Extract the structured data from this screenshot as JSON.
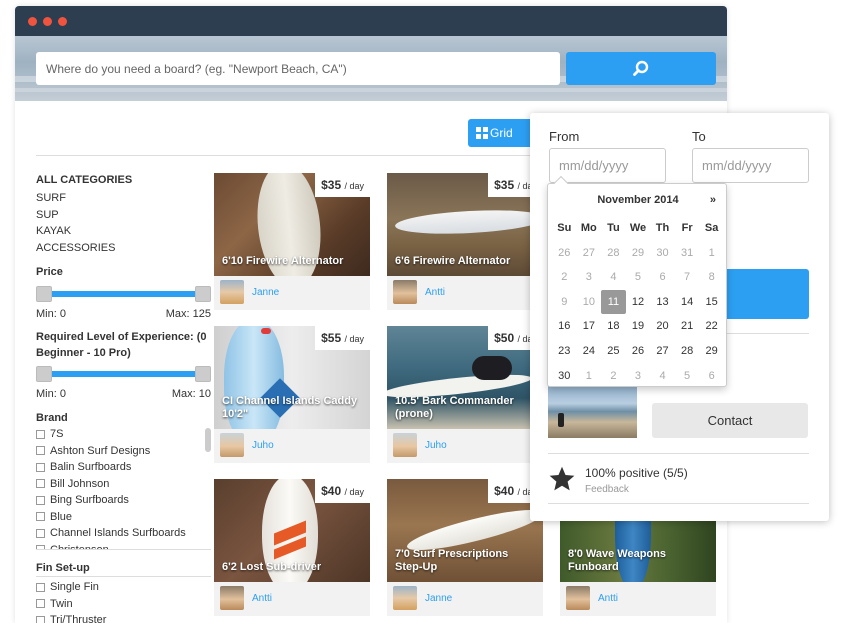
{
  "search": {
    "placeholder": "Where do you need a board? (eg. \"Newport Beach, CA\")",
    "button_icon": "search-icon"
  },
  "toolbar": {
    "grid_label": "Grid"
  },
  "sidebar": {
    "categories_title": "ALL CATEGORIES",
    "categories": [
      "SURF",
      "SUP",
      "KAYAK",
      "ACCESSORIES"
    ],
    "price": {
      "label": "Price",
      "min_label": "Min: 0",
      "max_label": "Max: 125"
    },
    "experience": {
      "label": "Required Level of Experience: (0 Beginner - 10 Pro)",
      "min_label": "Min: 0",
      "max_label": "Max: 10"
    },
    "brand": {
      "label": "Brand",
      "items": [
        "7S",
        "Ashton Surf Designs",
        "Balin Surfboards",
        "Bill Johnson",
        "Bing Surfboards",
        "Blue",
        "Channel Islands Surfboards",
        "Christenson"
      ]
    },
    "fin": {
      "label": "Fin Set-up",
      "items": [
        "Single Fin",
        "Twin",
        "Tri/Thruster"
      ]
    }
  },
  "listings": [
    {
      "title": "6'10 Firewire Alternator",
      "price": "$35",
      "unit": "/ day",
      "owner": "Janne"
    },
    {
      "title": "6'6 Firewire Alternator",
      "price": "$35",
      "unit": "/ day",
      "owner": "Antti"
    },
    {
      "title": "CI Channel Islands Caddy 10'2\"",
      "price": "$55",
      "unit": "/ day",
      "owner": "Juho"
    },
    {
      "title": "10.5' Bark Commander (prone)",
      "price": "$50",
      "unit": "/ day",
      "owner": "Juho"
    },
    {
      "title": "6'2 Lost Sub-driver",
      "price": "$40",
      "unit": "/ day",
      "owner": "Antti"
    },
    {
      "title": "7'0 Surf Prescriptions Step-Up",
      "price": "$40",
      "unit": "/ day",
      "owner": "Janne"
    },
    {
      "title": "8'0 Wave Weapons Funboard",
      "price": "",
      "unit": "",
      "owner": "Antti"
    }
  ],
  "booking": {
    "from_label": "From",
    "to_label": "To",
    "from_placeholder": "mm/dd/yyyy",
    "to_placeholder": "mm/dd/yyyy",
    "contact_label": "Contact",
    "rating": "100% positive (5/5)",
    "feedback_label": "Feedback"
  },
  "calendar": {
    "month": "November 2014",
    "next": "»",
    "weekdays": [
      "Su",
      "Mo",
      "Tu",
      "We",
      "Th",
      "Fr",
      "Sa"
    ],
    "weeks": [
      [
        "26",
        "27",
        "28",
        "29",
        "30",
        "31",
        "1"
      ],
      [
        "2",
        "3",
        "4",
        "5",
        "6",
        "7",
        "8"
      ],
      [
        "9",
        "10",
        "11",
        "12",
        "13",
        "14",
        "15"
      ],
      [
        "16",
        "17",
        "18",
        "19",
        "20",
        "21",
        "22"
      ],
      [
        "23",
        "24",
        "25",
        "26",
        "27",
        "28",
        "29"
      ],
      [
        "30",
        "1",
        "2",
        "3",
        "4",
        "5",
        "6"
      ]
    ],
    "selected": "11"
  },
  "colors": {
    "accent": "#2c9ff2",
    "titlebar": "#2d3e50",
    "traffic_dot": "#f0533e"
  }
}
